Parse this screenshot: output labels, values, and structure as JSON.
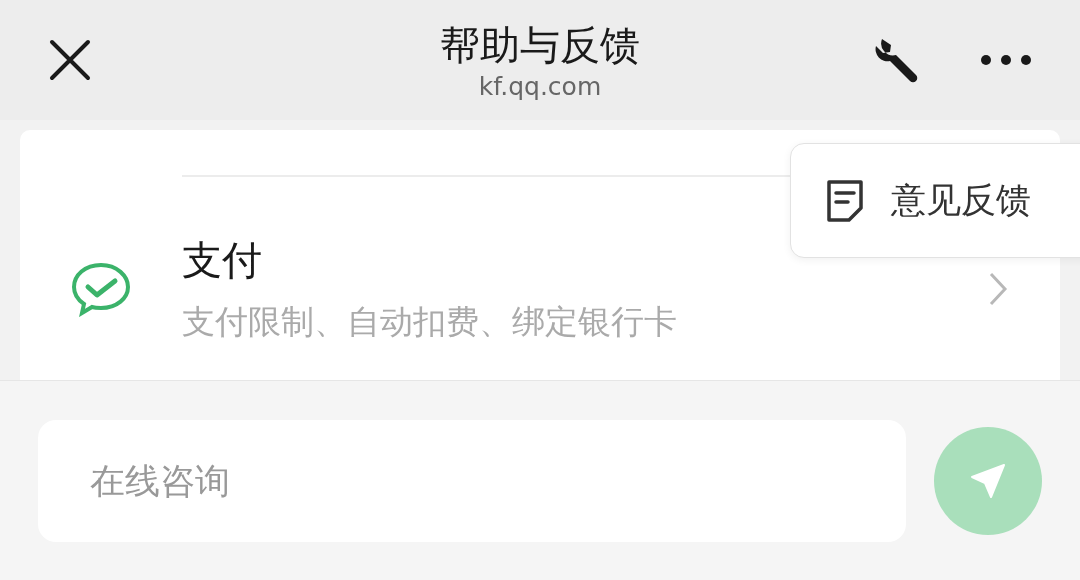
{
  "header": {
    "title": "帮助与反馈",
    "subtitle": "kf.qq.com"
  },
  "list": {
    "items": [
      {
        "title": "支付",
        "description": "支付限制、自动扣费、绑定银行卡"
      }
    ]
  },
  "popup_menu": {
    "items": [
      {
        "label": "意见反馈"
      }
    ]
  },
  "composer": {
    "placeholder": "在线咨询",
    "send_disabled": true
  }
}
